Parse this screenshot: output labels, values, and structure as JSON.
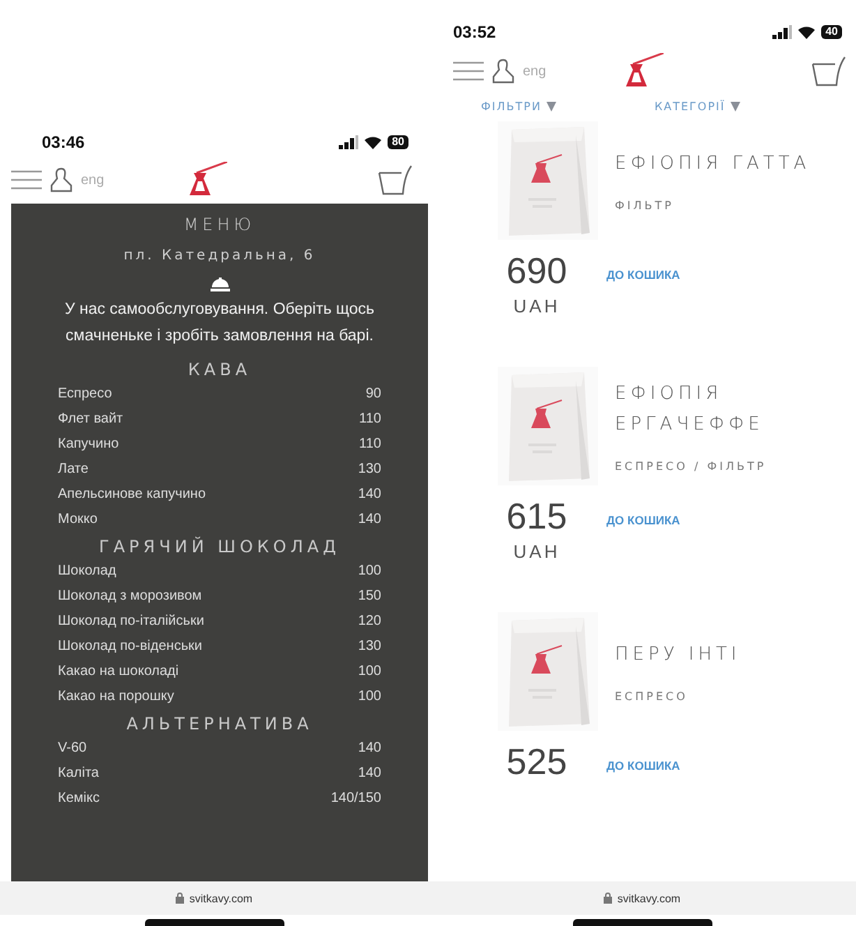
{
  "left_phone": {
    "status": {
      "time": "03:46",
      "battery": "80"
    },
    "header": {
      "lang": "eng"
    },
    "menu": {
      "title": "МЕНЮ",
      "address": "пл. Катедральна, 6",
      "notice": "У нас самообслуговування. Оберіть щось смачненьке і зробіть замовлення на барі.",
      "sections": [
        {
          "title": "КАВА",
          "items": [
            {
              "name": "Еспресо",
              "price": "90"
            },
            {
              "name": "Флет вайт",
              "price": "110"
            },
            {
              "name": "Капучино",
              "price": "110"
            },
            {
              "name": "Лате",
              "price": "130"
            },
            {
              "name": "Апельсинове капучино",
              "price": "140"
            },
            {
              "name": "Мокко",
              "price": "140"
            }
          ]
        },
        {
          "title": "ГАРЯЧИЙ ШОКОЛАД",
          "items": [
            {
              "name": "Шоколад",
              "price": "100"
            },
            {
              "name": "Шоколад з морозивом",
              "price": "150"
            },
            {
              "name": "Шоколад по-італійськи",
              "price": "120"
            },
            {
              "name": "Шоколад по-віденськи",
              "price": "130"
            },
            {
              "name": "Какао на шоколаді",
              "price": "100"
            },
            {
              "name": "Какао на порошку",
              "price": "100"
            }
          ]
        },
        {
          "title": "АЛЬТЕРНАТИВА",
          "items": [
            {
              "name": "V-60",
              "price": "140"
            },
            {
              "name": "Каліта",
              "price": "140"
            },
            {
              "name": "Кемікс",
              "price": "140/150"
            }
          ]
        }
      ]
    },
    "url": "svitkavy.com"
  },
  "right_phone": {
    "status": {
      "time": "03:52",
      "battery": "40"
    },
    "header": {
      "lang": "eng"
    },
    "filters": [
      "ФІЛЬТРИ",
      "КАТЕГОРІЇ"
    ],
    "products": [
      {
        "name": "ЕФІОПІЯ ГАТТА",
        "category": "ФІЛЬТР",
        "price": "690",
        "currency": "UAH",
        "button": "ДО КОШИКА"
      },
      {
        "name": "ЕФІОПІЯ ЕРГАЧЕФФЕ",
        "category": "ЕСПРЕСО / ФІЛЬТР",
        "price": "615",
        "currency": "UAH",
        "button": "ДО КОШИКА"
      },
      {
        "name": "ПЕРУ ІНТІ",
        "category": "ЕСПРЕСО",
        "price": "525",
        "button": "ДО КОШИКА"
      }
    ],
    "url": "svitkavy.com"
  }
}
